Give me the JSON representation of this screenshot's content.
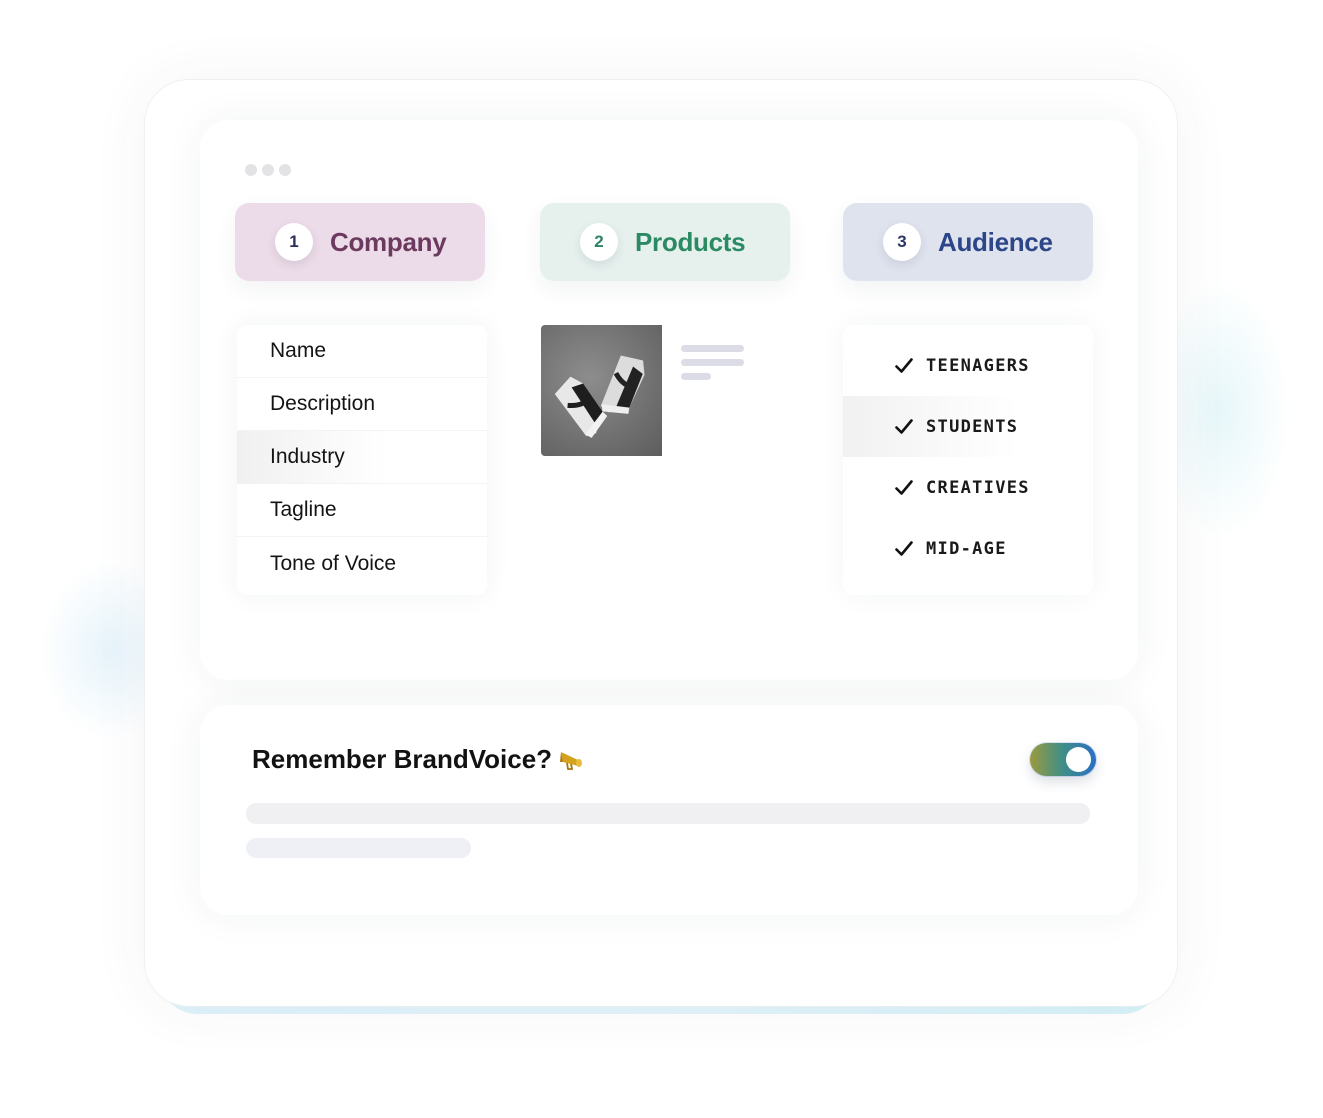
{
  "window": {
    "controls": [
      "dot",
      "dot",
      "dot"
    ]
  },
  "steps": [
    {
      "number": "1",
      "label": "Company",
      "color": "#6b3a5e",
      "bg": "#ecdbe8"
    },
    {
      "number": "2",
      "label": "Products",
      "color": "#2b8a63",
      "bg": "#e6f1ee"
    },
    {
      "number": "3",
      "label": "Audience",
      "color": "#2d4589",
      "bg": "#dfe3ee"
    }
  ],
  "company_fields": [
    "Name",
    "Description",
    "Industry",
    "Tagline",
    "Tone of Voice"
  ],
  "company_active_field": "Industry",
  "products": {
    "image_icon": "sneakers-photo",
    "text_placeholder_icon": "text-lines"
  },
  "audience": {
    "items": [
      "TEENAGERS",
      "STUDENTS",
      "CREATIVES",
      "MID-AGE"
    ],
    "active_item": "STUDENTS",
    "check_icon": "checkmark-icon"
  },
  "remember": {
    "title": "Remember BrandVoice?",
    "emoji_icon": "megaphone-icon",
    "toggle_on": true,
    "toggle_colors": [
      "#9c9a3e",
      "#3e8e88",
      "#2b6fc4"
    ]
  }
}
